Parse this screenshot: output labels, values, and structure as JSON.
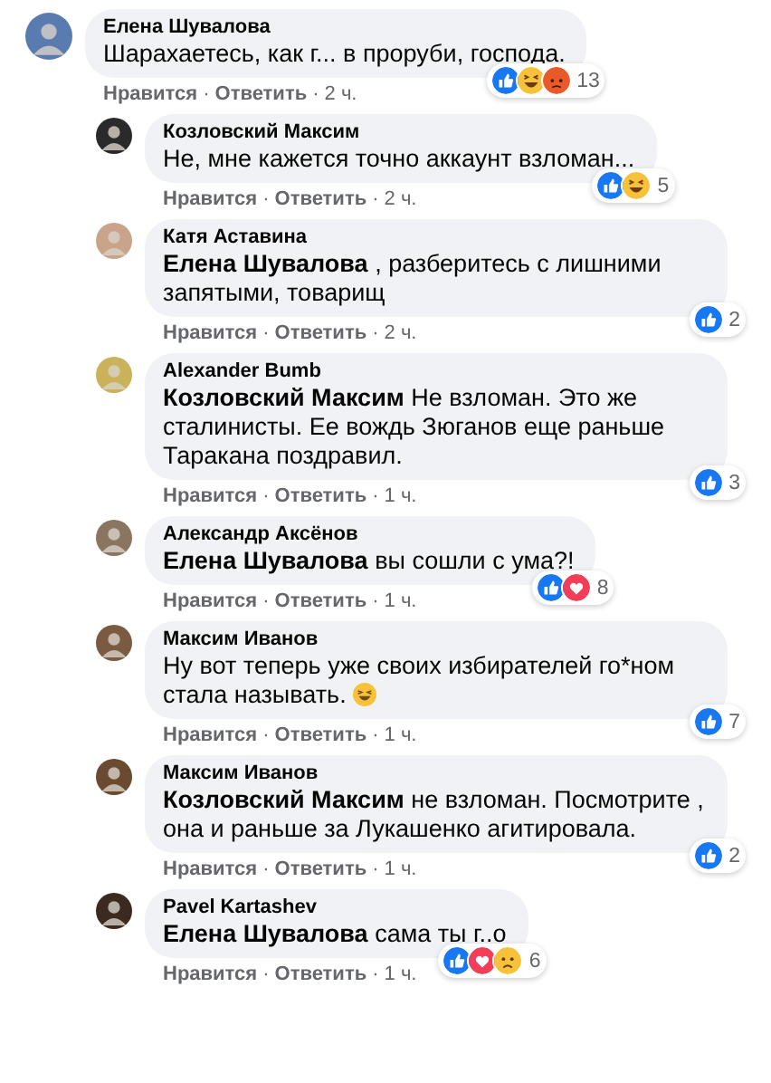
{
  "comments": [
    {
      "kind": "comment",
      "author": "Елена Шувалова",
      "text": "Шарахаетесь, как г... в проруби, господа.",
      "reactions": [
        {
          "kind": "like"
        },
        {
          "kind": "haha"
        },
        {
          "kind": "angry"
        }
      ],
      "reaction_count": "13",
      "like": "Нравится",
      "sep1": "·",
      "reply": "Ответить",
      "sep2": "·",
      "time": "2 ч."
    },
    {
      "kind": "reply",
      "author": "Козловский Максим",
      "text": "Не, мне кажется точно аккаунт взломан...",
      "reactions": [
        {
          "kind": "like"
        },
        {
          "kind": "haha"
        }
      ],
      "reaction_count": "5",
      "like": "Нравится",
      "sep1": "·",
      "reply": "Ответить",
      "sep2": "·",
      "time": "2 ч."
    },
    {
      "kind": "reply",
      "author": "Катя Аставина",
      "text": "**Елена Шувалова** , разберитесь с лишними запятыми, товарищ",
      "reactions": [
        {
          "kind": "like"
        }
      ],
      "reaction_count": "2",
      "like": "Нравится",
      "sep1": "·",
      "reply": "Ответить",
      "sep2": "·",
      "time": "2 ч."
    },
    {
      "kind": "reply",
      "author": "Alexander Bumb",
      "text": "**Козловский Максим** Не взломан. Это же сталинисты. Ее вождь Зюганов еще раньше Таракана поздравил.",
      "reactions": [
        {
          "kind": "like"
        }
      ],
      "reaction_count": "3",
      "like": "Нравится",
      "sep1": "·",
      "reply": "Ответить",
      "sep2": "·",
      "time": "1 ч."
    },
    {
      "kind": "reply",
      "author": "Александр Аксёнов",
      "text": "**Елена Шувалова** вы сошли с ума?!",
      "reactions": [
        {
          "kind": "like"
        },
        {
          "kind": "love"
        }
      ],
      "reaction_count": "8",
      "like": "Нравится",
      "sep1": "·",
      "reply": "Ответить",
      "sep2": "·",
      "time": "1 ч."
    },
    {
      "kind": "reply",
      "author": "Максим Иванов",
      "text": "Ну вот теперь уже своих избирателей го*ном стала называть.",
      "emojis": [
        {
          "kind": "laughing"
        }
      ],
      "reactions": [
        {
          "kind": "like"
        }
      ],
      "reaction_count": "7",
      "like": "Нравится",
      "sep1": "·",
      "reply": "Ответить",
      "sep2": "·",
      "time": "1 ч."
    },
    {
      "kind": "reply",
      "author": "Максим Иванов",
      "text": "**Козловский Максим** не взломан. Посмотрите , она и раньше за Лукашенко агитировала.",
      "reactions": [
        {
          "kind": "like"
        }
      ],
      "reaction_count": "2",
      "like": "Нравится",
      "sep1": "·",
      "reply": "Ответить",
      "sep2": "·",
      "time": "1 ч."
    },
    {
      "kind": "reply",
      "author": "Pavel Kartashev",
      "text": "**Елена Шувалова** сама ты г..о",
      "reactions": [
        {
          "kind": "like"
        },
        {
          "kind": "love"
        },
        {
          "kind": "sad"
        }
      ],
      "reaction_count": "6",
      "like": "Нравится",
      "sep1": "·",
      "reply": "Ответить",
      "sep2": "·",
      "time": "1 ч."
    }
  ]
}
